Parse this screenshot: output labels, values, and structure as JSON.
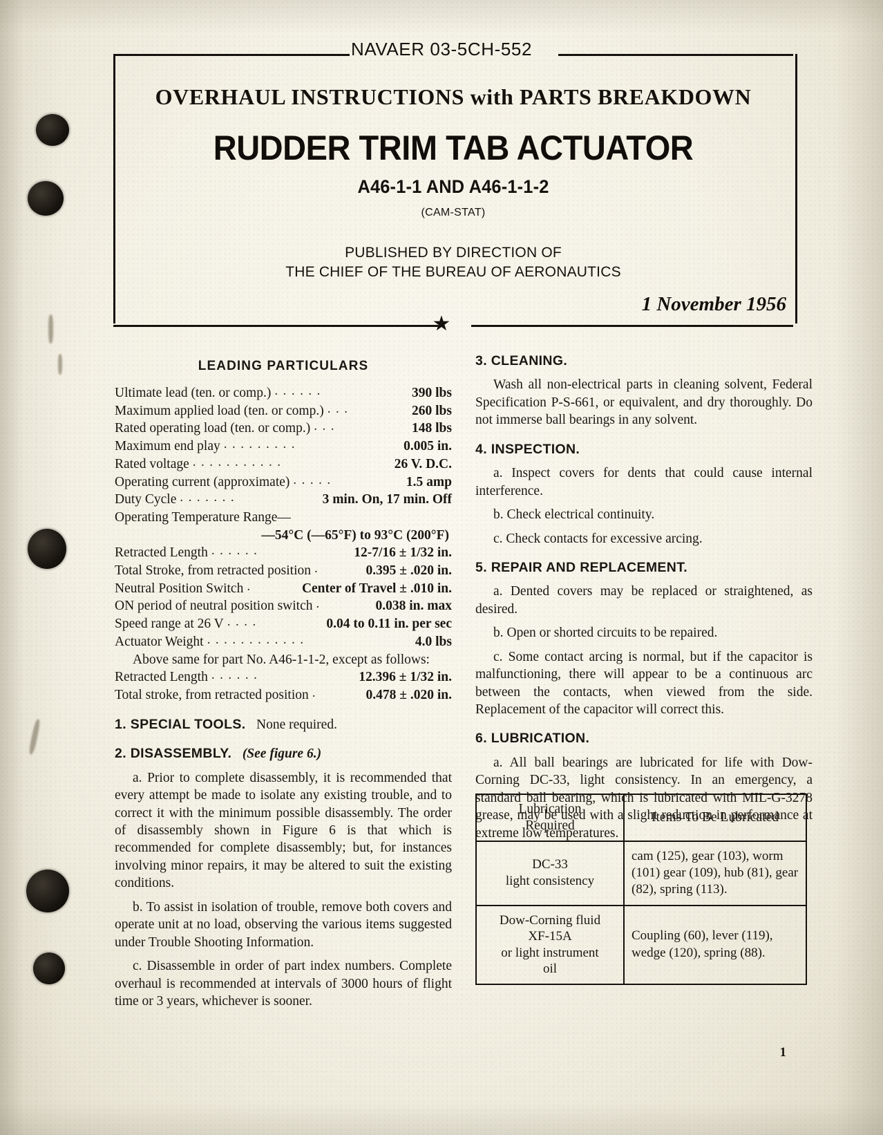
{
  "header": {
    "navaer_number": "NAVAER 03-5CH-552",
    "overhaul_line": "OVERHAUL  INSTRUCTIONS  with  PARTS  BREAKDOWN",
    "main_title": "RUDDER TRIM TAB ACTUATOR",
    "part_numbers": "A46-1-1 AND A46-1-1-2",
    "cam_stat": "(CAM-STAT)",
    "published_line1": "PUBLISHED BY DIRECTION OF",
    "published_line2": "THE CHIEF OF THE BUREAU OF AERONAUTICS",
    "date": "1 November 1956",
    "star_glyph": "★"
  },
  "leading_particulars": {
    "title": "LEADING PARTICULARS",
    "rows": [
      {
        "label": "Ultimate lead (ten. or comp.)",
        "value": "390 lbs",
        "dots": 6
      },
      {
        "label": "Maximum applied load (ten. or comp.)",
        "value": "260 lbs",
        "dots": 3
      },
      {
        "label": "Rated operating load (ten. or comp.)",
        "value": "148 lbs",
        "dots": 3
      },
      {
        "label": "Maximum end play",
        "value": "0.005 in.",
        "dots": 9
      },
      {
        "label": "Rated voltage",
        "value": "26 V. D.C.",
        "dots": 11
      },
      {
        "label": "Operating current (approximate)",
        "value": "1.5 amp",
        "dots": 5
      },
      {
        "label": "Duty Cycle",
        "value": "3 min. On, 17 min. Off",
        "dots": 7
      }
    ],
    "temp_range_label": "Operating Temperature Range—",
    "temp_range_value": "—54°C (—65°F) to 93°C (200°F)",
    "rows2": [
      {
        "label": "Retracted Length",
        "value": "12-7/16 ± 1/32 in.",
        "dots": 6
      },
      {
        "label": "Total Stroke, from retracted position",
        "value": "0.395 ± .020 in.",
        "dots": 1
      },
      {
        "label": "Neutral Position Switch",
        "value": "Center of Travel ± .010 in.",
        "dots": 1
      },
      {
        "label": "ON period of neutral position switch",
        "value": "0.038 in. max",
        "dots": 1
      },
      {
        "label": "Speed range at 26 V",
        "value": "0.04 to 0.11 in. per sec",
        "dots": 4
      },
      {
        "label": "Actuator Weight",
        "value": "4.0 lbs",
        "dots": 12
      }
    ],
    "note": "Above same for part No. A46-1-1-2, except as follows:",
    "rows3": [
      {
        "label": "Retracted Length",
        "value": "12.396 ± 1/32 in.",
        "dots": 6
      },
      {
        "label": "Total stroke, from retracted position",
        "value": "0.478 ± .020 in.",
        "dots": 1
      }
    ]
  },
  "sections": {
    "special_tools": {
      "number": "1.",
      "heading": "SPECIAL TOOLS.",
      "body": "None required."
    },
    "disassembly": {
      "number": "2.",
      "heading": "DISASSEMBLY.",
      "figure_ref": "(See figure 6.)",
      "paragraphs": [
        "a. Prior to complete disassembly, it is recommended that every attempt be made to isolate any existing trouble, and to correct it with the minimum possible disassembly. The order of disassembly shown in Figure 6 is that which is recommended for complete disassembly; but, for instances involving minor repairs, it may be altered to suit the existing conditions.",
        "b. To assist in isolation of trouble, remove both covers and operate unit at no load, observing the various items suggested under Trouble Shooting Information.",
        "c. Disassemble in order of part index numbers. Complete overhaul is recommended at intervals of 3000 hours of flight time or 3 years, whichever is sooner."
      ]
    },
    "cleaning": {
      "number": "3.",
      "heading": "CLEANING.",
      "paragraphs": [
        "Wash all non-electrical parts in cleaning solvent, Federal Specification P-S-661, or equivalent, and dry thoroughly. Do not immerse ball bearings in any solvent."
      ]
    },
    "inspection": {
      "number": "4.",
      "heading": "INSPECTION.",
      "paragraphs": [
        "a. Inspect covers for dents that could cause internal interference.",
        "b. Check electrical continuity.",
        "c. Check contacts for excessive arcing."
      ]
    },
    "repair": {
      "number": "5.",
      "heading": "REPAIR AND REPLACEMENT.",
      "paragraphs": [
        "a. Dented covers may be replaced or straightened, as desired.",
        "b. Open or shorted circuits to be repaired.",
        "c. Some contact arcing is normal, but if the capacitor is malfunctioning, there will appear to be a continuous arc between the contacts, when viewed from the side. Replacement of the capacitor will correct this."
      ]
    },
    "lubrication": {
      "number": "6.",
      "heading": "LUBRICATION.",
      "paragraphs": [
        "a. All ball bearings are lubricated for life with Dow-Corning DC-33, light consistency. In an emergency, a standard ball bearing, which is lubricated with MIL-G-3278 grease, may be used with a slight reduction in performance at extreme low temperatures."
      ]
    }
  },
  "lubrication_table": {
    "headers": [
      "Lubrication\nRequired",
      "Items To Be Lubricated"
    ],
    "header_col1_line1": "Lubrication",
    "header_col1_line2": "Required",
    "header_col2": "Items To Be Lubricated",
    "rows": [
      {
        "lubricant_line1": "DC-33",
        "lubricant_line2": "light consistency",
        "items": "cam (125), gear (103), worm (101) gear (109), hub (81), gear (82), spring (113)."
      },
      {
        "lubricant_line1": "Dow-Corning fluid",
        "lubricant_line2": "XF-15A",
        "lubricant_line3": "or light instrument",
        "lubricant_line4": "oil",
        "items": "Coupling (60), lever (119), wedge (120), spring (88)."
      }
    ]
  },
  "page_number": "1"
}
